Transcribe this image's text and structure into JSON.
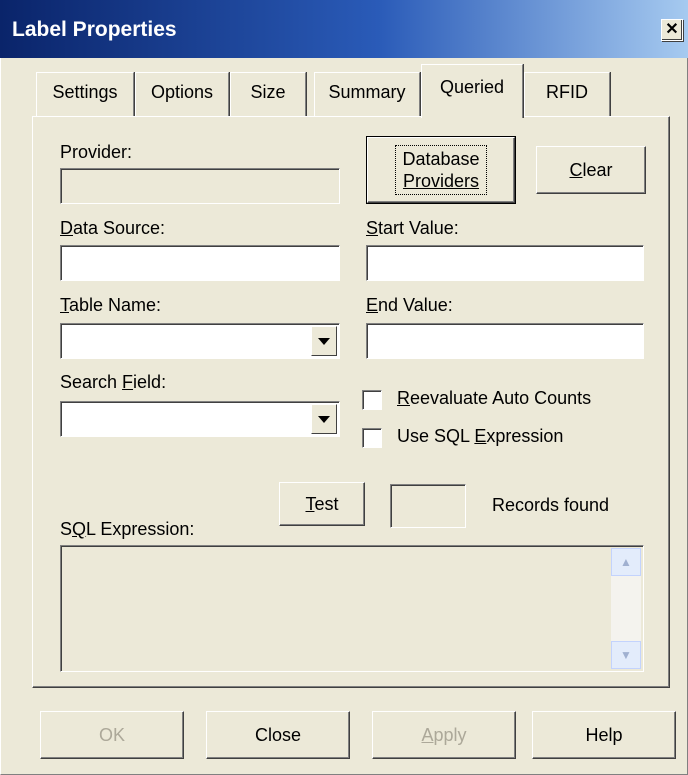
{
  "window": {
    "title": "Label Properties",
    "close_glyph": "✕"
  },
  "tabs": [
    {
      "label": "Settings"
    },
    {
      "label": "Options"
    },
    {
      "label": "Size"
    },
    {
      "label": "Summary"
    },
    {
      "label": "Queried",
      "active": true
    },
    {
      "label": "RFID"
    }
  ],
  "form": {
    "provider_label": "Provider:",
    "provider_value": "",
    "database_providers_line1": "Database",
    "database_providers_line2": "Providers",
    "clear_label_mnemonic": "C",
    "clear_label_rest": "lear",
    "data_source_label_mnemonic": "D",
    "data_source_label_rest": "ata Source:",
    "data_source_value": "",
    "start_value_label_mnemonic": "S",
    "start_value_label_rest": "tart Value:",
    "start_value_value": "",
    "table_name_label_mnemonic": "T",
    "table_name_label_rest": "able Name:",
    "table_name_value": "",
    "end_value_label_mnemonic": "E",
    "end_value_label_rest": "nd Value:",
    "end_value_value": "",
    "search_field_label_pre": "Search ",
    "search_field_label_mnemonic": "F",
    "search_field_label_rest": "ield:",
    "search_field_value": "",
    "reevaluate_label_mnemonic": "R",
    "reevaluate_label_rest": "eevaluate Auto Counts",
    "reevaluate_checked": false,
    "use_sql_label_pre": "Use SQL ",
    "use_sql_label_mnemonic": "E",
    "use_sql_label_rest": "xpression",
    "use_sql_checked": false,
    "test_label_mnemonic": "T",
    "test_label_rest": "est",
    "records_found_count": "",
    "records_found_label": "Records found",
    "sql_expression_label_pre": "S",
    "sql_expression_label_mnemonic": "Q",
    "sql_expression_label_rest": "L Expression:",
    "sql_expression_value": ""
  },
  "footer": {
    "ok_label": "OK",
    "close_label": "Close",
    "apply_label_mnemonic": "A",
    "apply_label_rest": "pply",
    "help_label": "Help"
  },
  "icons": {
    "dropdown": "chevron-down-icon",
    "scroll_up": "scroll-up-arrow-icon",
    "scroll_down": "scroll-down-arrow-icon",
    "close": "close-icon"
  },
  "colors": {
    "title_gradient_start": "#0a246a",
    "title_gradient_end": "#a6caf0",
    "dialog_background": "#ece9d8",
    "disabled_text": "#aca899"
  }
}
